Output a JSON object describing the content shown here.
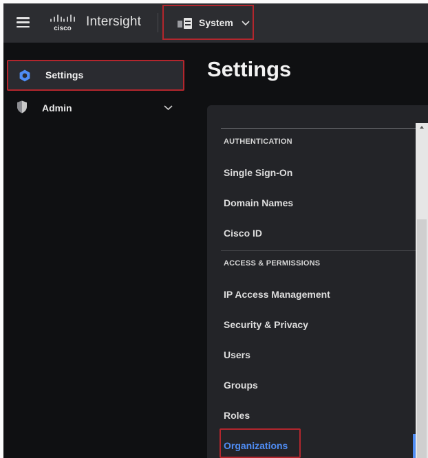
{
  "topbar": {
    "brand": "Intersight",
    "logo_text": "cisco",
    "system_label": "System"
  },
  "sidebar": {
    "items": [
      {
        "label": "Settings",
        "icon": "gear-icon",
        "active": true
      },
      {
        "label": "Admin",
        "icon": "shield-icon",
        "expandable": true
      }
    ]
  },
  "main": {
    "title": "Settings",
    "sections": [
      {
        "heading": "AUTHENTICATION",
        "items": [
          "Single Sign-On",
          "Domain Names",
          "Cisco ID"
        ]
      },
      {
        "heading": "ACCESS & PERMISSIONS",
        "items": [
          "IP Access Management",
          "Security & Privacy",
          "Users",
          "Groups",
          "Roles",
          "Organizations"
        ]
      }
    ],
    "selected_item": "Organizations"
  },
  "colors": {
    "accent": "#4f8df5",
    "highlight_border": "#b3262d",
    "topbar_bg": "#2c2d31",
    "panel_bg": "#232428",
    "page_bg": "#0f1012"
  }
}
